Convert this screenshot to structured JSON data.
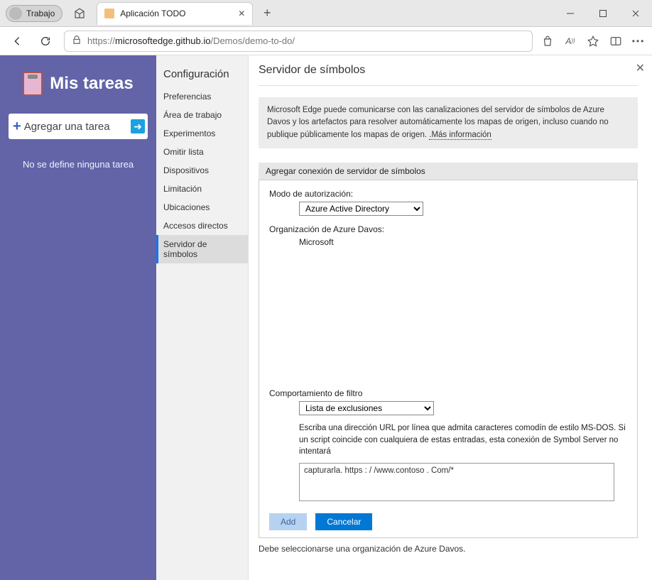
{
  "browser": {
    "profile_label": "Trabajo",
    "tab_title": "Aplicación TODO",
    "url_protocol": "https://",
    "url_host": "microsoftedge.github.io",
    "url_path": "/Demos/demo-to-do/"
  },
  "sidebar": {
    "app_title": "Mis tareas",
    "add_task_label": "Agregar una tarea",
    "empty_message": "No se define ninguna tarea"
  },
  "config": {
    "title": "Configuración",
    "items": [
      "Preferencias",
      "Área de trabajo",
      "Experimentos",
      "Omitir lista",
      "Dispositivos",
      "Limitación",
      "Ubicaciones",
      "Accesos directos",
      "Servidor de símbolos"
    ],
    "active_index": 8
  },
  "settings": {
    "heading": "Servidor de símbolos",
    "info_text": "Microsoft Edge puede comunicarse con las canalizaciones del servidor de símbolos de Azure Davos y los artefactos para resolver automáticamente los mapas de origen, incluso cuando no publique públicamente los mapas de origen.",
    "more_info_label": "Más información",
    "section_header": "Agregar conexión de servidor de símbolos",
    "auth_mode_label": "Modo de autorización:",
    "auth_mode_value": "Azure Active Directory",
    "org_label": "Organización de Azure Davos:",
    "org_value": "Microsoft",
    "filter_label": "Comportamiento de filtro",
    "filter_value": "Lista de exclusiones",
    "filter_help": "Escriba una dirección URL por línea que admita caracteres comodín de estilo MS-DOS. Si un script coincide con cualquiera de estas entradas, esta conexión de Symbol Server no intentará",
    "textarea_value": "capturarla. https : / /www.contoso . Com/*",
    "add_btn": "Add",
    "cancel_btn": "Cancelar",
    "validation_msg": "Debe seleccionarse una organización de Azure Davos."
  }
}
